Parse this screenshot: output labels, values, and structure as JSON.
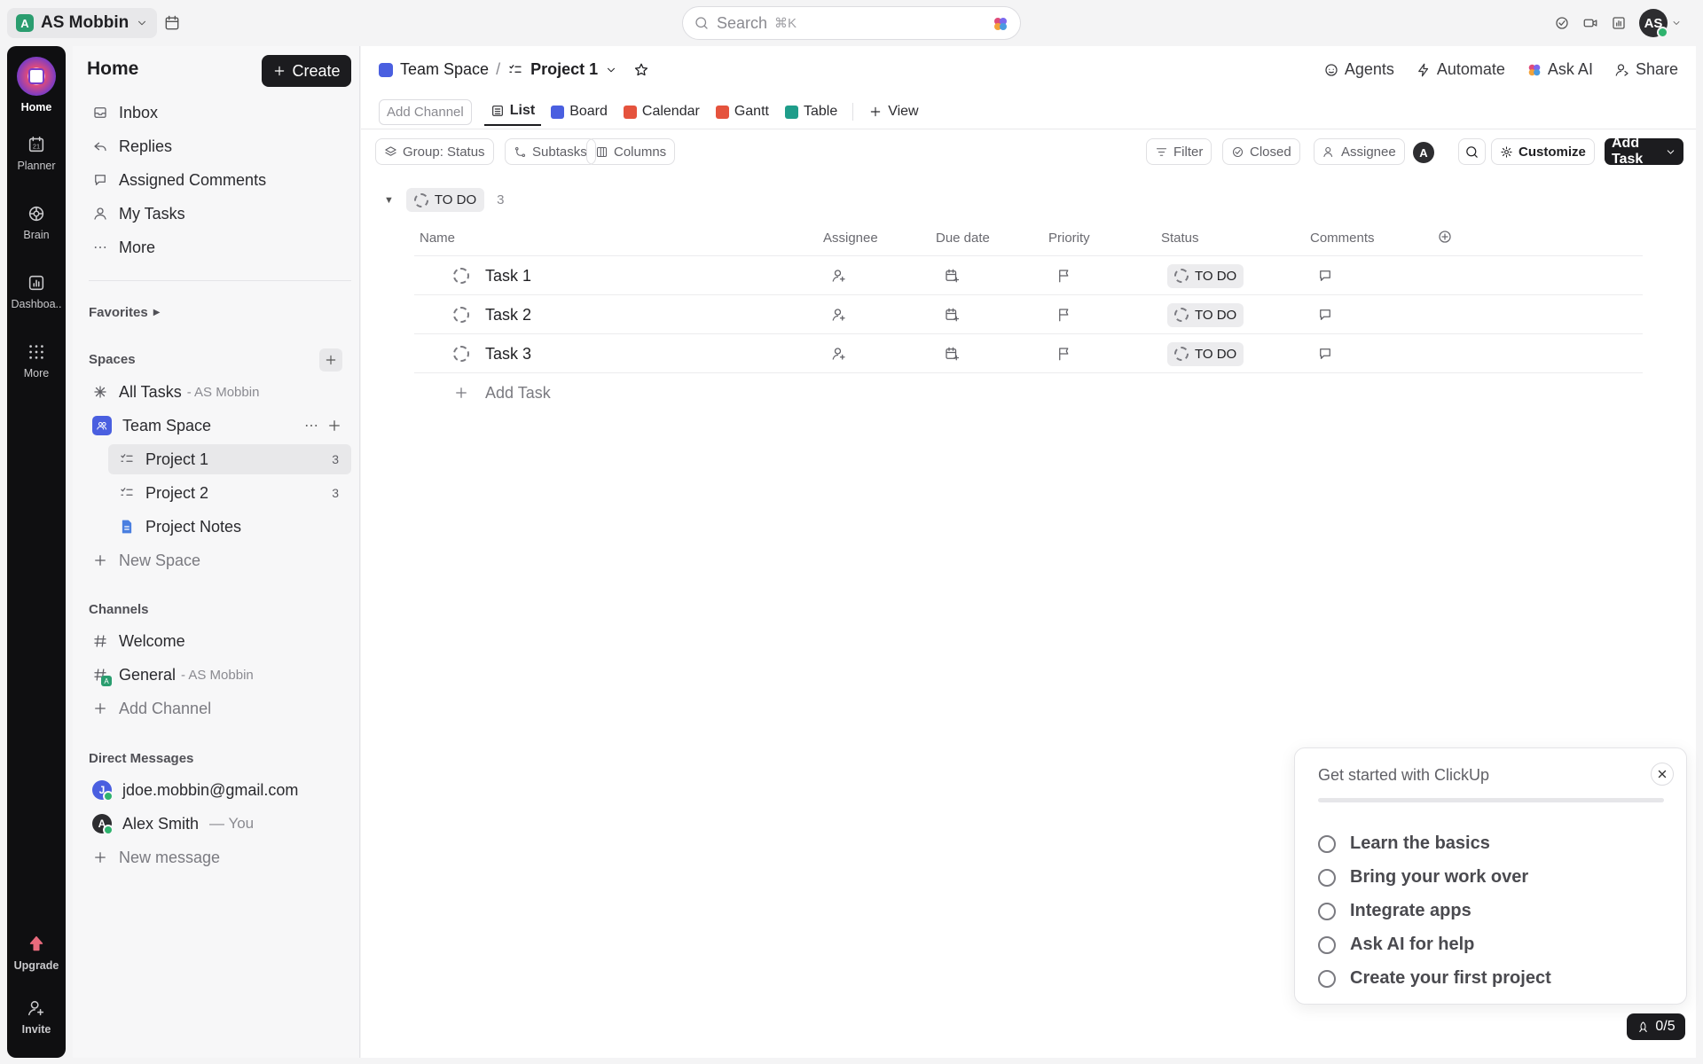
{
  "topbar": {
    "workspace_initial": "A",
    "workspace_name": "AS Mobbin",
    "search_placeholder": "Search",
    "search_shortcut": "⌘K",
    "avatar_initials": "AS"
  },
  "rail": {
    "items": [
      {
        "label": "Home",
        "icon": "home-icon"
      },
      {
        "label": "Planner",
        "icon": "planner-icon"
      },
      {
        "label": "Brain",
        "icon": "brain-icon"
      },
      {
        "label": "Dashboa..",
        "icon": "dashboard-icon"
      },
      {
        "label": "More",
        "icon": "grid-icon"
      }
    ],
    "bottom": [
      {
        "label": "Upgrade",
        "icon": "upgrade-icon"
      },
      {
        "label": "Invite",
        "icon": "invite-icon"
      }
    ],
    "planner_day": "21"
  },
  "sidebar": {
    "title": "Home",
    "create_label": "Create",
    "nav": [
      {
        "label": "Inbox",
        "icon": "inbox-icon"
      },
      {
        "label": "Replies",
        "icon": "reply-icon"
      },
      {
        "label": "Assigned Comments",
        "icon": "comment-icon"
      },
      {
        "label": "My Tasks",
        "icon": "user-icon"
      },
      {
        "label": "More",
        "icon": "more-icon"
      }
    ],
    "favorites_label": "Favorites",
    "spaces_label": "Spaces",
    "all_tasks": {
      "label": "All Tasks",
      "suffix": "- AS Mobbin"
    },
    "team_space": "Team Space",
    "lists": [
      {
        "label": "Project 1",
        "count": "3"
      },
      {
        "label": "Project 2",
        "count": "3"
      },
      {
        "label": "Project Notes",
        "count": ""
      }
    ],
    "new_space": "New Space",
    "channels_label": "Channels",
    "channels": [
      {
        "label": "Welcome",
        "suffix": ""
      },
      {
        "label": "General",
        "suffix": "- AS Mobbin"
      }
    ],
    "add_channel": "Add Channel",
    "dm_label": "Direct Messages",
    "dms": [
      {
        "label": "jdoe.mobbin@gmail.com",
        "initial": "J",
        "suffix": ""
      },
      {
        "label": "Alex Smith",
        "initial": "A",
        "suffix": "— You"
      }
    ],
    "new_message": "New message"
  },
  "main": {
    "breadcrumb": {
      "space": "Team Space",
      "separator": "/",
      "list": "Project 1"
    },
    "actions": [
      "Agents",
      "Automate",
      "Ask AI",
      "Share"
    ],
    "add_channel": "Add Channel",
    "views": [
      {
        "label": "List",
        "color": "#2a2a2e"
      },
      {
        "label": "Board",
        "color": "#4a5fe0"
      },
      {
        "label": "Calendar",
        "color": "#e5533d"
      },
      {
        "label": "Gantt",
        "color": "#e5533d"
      },
      {
        "label": "Table",
        "color": "#1f9d8a"
      }
    ],
    "add_view": "View",
    "toolbar": {
      "group": "Group: Status",
      "subtasks": "Subtasks",
      "columns": "Columns",
      "filter": "Filter",
      "closed": "Closed",
      "assignee": "Assignee",
      "assignee_avatar": "A",
      "customize": "Customize",
      "add_task": "Add Task"
    },
    "group": {
      "status": "TO DO",
      "count": "3"
    },
    "columns": [
      "Name",
      "Assignee",
      "Due date",
      "Priority",
      "Status",
      "Comments"
    ],
    "tasks": [
      {
        "name": "Task 1",
        "status": "TO DO"
      },
      {
        "name": "Task 2",
        "status": "TO DO"
      },
      {
        "name": "Task 3",
        "status": "TO DO"
      }
    ],
    "add_task_row": "Add Task"
  },
  "get_started": {
    "title": "Get started with ClickUp",
    "progress": 0,
    "items": [
      "Learn the basics",
      "Bring your work over",
      "Integrate apps",
      "Ask AI for help",
      "Create your first project"
    ],
    "progress_label": "0/5"
  }
}
